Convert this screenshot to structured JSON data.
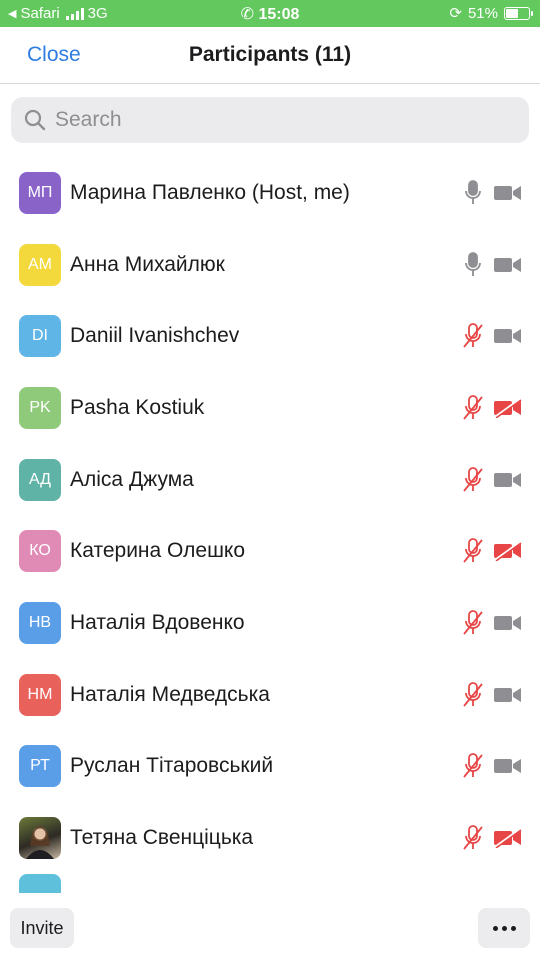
{
  "status_bar": {
    "back_app": "Safari",
    "network": "3G",
    "time": "15:08",
    "battery": "51%"
  },
  "nav": {
    "close_label": "Close",
    "title": "Participants (11)"
  },
  "search": {
    "placeholder": "Search",
    "value": ""
  },
  "colors": {
    "accent": "#2f7de1",
    "muted_red": "#e84646",
    "icon_gray": "#8e8e93",
    "status_green": "#63c95e"
  },
  "participants": [
    {
      "initials": "МП",
      "name": "Марина Павленко",
      "suffix": " (Host, me)",
      "avatar_color": "#8a63c9",
      "mic": "on",
      "cam": "on"
    },
    {
      "initials": "АМ",
      "name": "Анна Михайлюк",
      "suffix": "",
      "avatar_color": "#f4d93d",
      "mic": "on",
      "cam": "on"
    },
    {
      "initials": "DI",
      "name": "Daniil Ivanishchev",
      "suffix": "",
      "avatar_color": "#5fb6e6",
      "mic": "muted",
      "cam": "on"
    },
    {
      "initials": "PK",
      "name": "Pasha Kostiuk",
      "suffix": "",
      "avatar_color": "#8fca7b",
      "mic": "muted",
      "cam": "off"
    },
    {
      "initials": "АД",
      "name": "Аліса Джума",
      "suffix": "",
      "avatar_color": "#5eb3a6",
      "mic": "muted",
      "cam": "on"
    },
    {
      "initials": "КО",
      "name": "Катерина Олешко",
      "suffix": "",
      "avatar_color": "#e08bb6",
      "mic": "muted",
      "cam": "off"
    },
    {
      "initials": "НВ",
      "name": "Наталія Вдовенко",
      "suffix": "",
      "avatar_color": "#5a9ee8",
      "mic": "muted",
      "cam": "on"
    },
    {
      "initials": "НМ",
      "name": "Наталія Медведська",
      "suffix": "",
      "avatar_color": "#e8615b",
      "mic": "muted",
      "cam": "on"
    },
    {
      "initials": "РТ",
      "name": "Руслан Тітаровський",
      "suffix": "",
      "avatar_color": "#5a9ee8",
      "mic": "muted",
      "cam": "on"
    },
    {
      "initials": "",
      "name": "Тетяна Свенціцька",
      "suffix": "",
      "avatar_color": "photo",
      "mic": "muted",
      "cam": "off"
    }
  ],
  "bottom": {
    "invite_label": "Invite",
    "more_icon": "ellipsis-icon"
  }
}
